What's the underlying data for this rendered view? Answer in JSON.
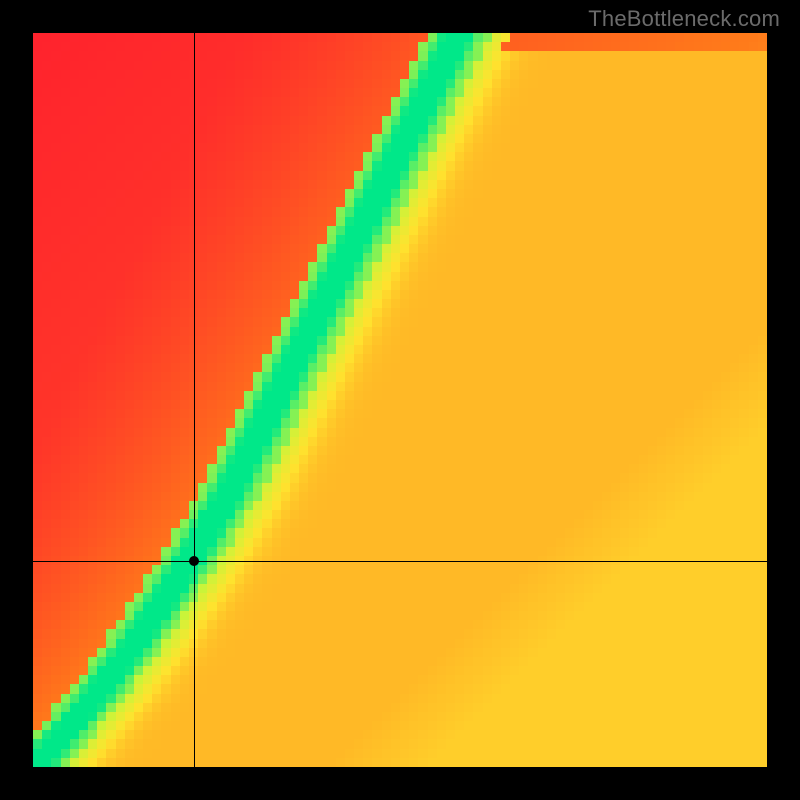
{
  "watermark": "TheBottleneck.com",
  "chart_data": {
    "type": "heatmap",
    "title": "",
    "xlabel": "",
    "ylabel": "",
    "xlim": [
      0,
      1
    ],
    "ylim": [
      0,
      1
    ],
    "grid_resolution": 80,
    "crosshair": {
      "x": 0.22,
      "y": 0.28
    },
    "marker": {
      "x": 0.22,
      "y": 0.28
    },
    "optimal_band": {
      "description": "green compatibility ridge through the heatmap",
      "points_xy": [
        [
          0.02,
          0.02
        ],
        [
          0.08,
          0.09
        ],
        [
          0.14,
          0.17
        ],
        [
          0.2,
          0.26
        ],
        [
          0.26,
          0.36
        ],
        [
          0.31,
          0.46
        ],
        [
          0.36,
          0.56
        ],
        [
          0.41,
          0.66
        ],
        [
          0.46,
          0.76
        ],
        [
          0.51,
          0.86
        ],
        [
          0.56,
          0.96
        ]
      ],
      "half_width_x": 0.035
    },
    "background_gradient": {
      "description": "diagonal warm gradient; red near left/top edges, orange-yellow toward lower-right away from band"
    },
    "color_stops": {
      "red": "#ff1e2e",
      "orange": "#ff7a1a",
      "yellow": "#ffe32e",
      "lime": "#c7f53a",
      "green": "#00e889"
    }
  }
}
